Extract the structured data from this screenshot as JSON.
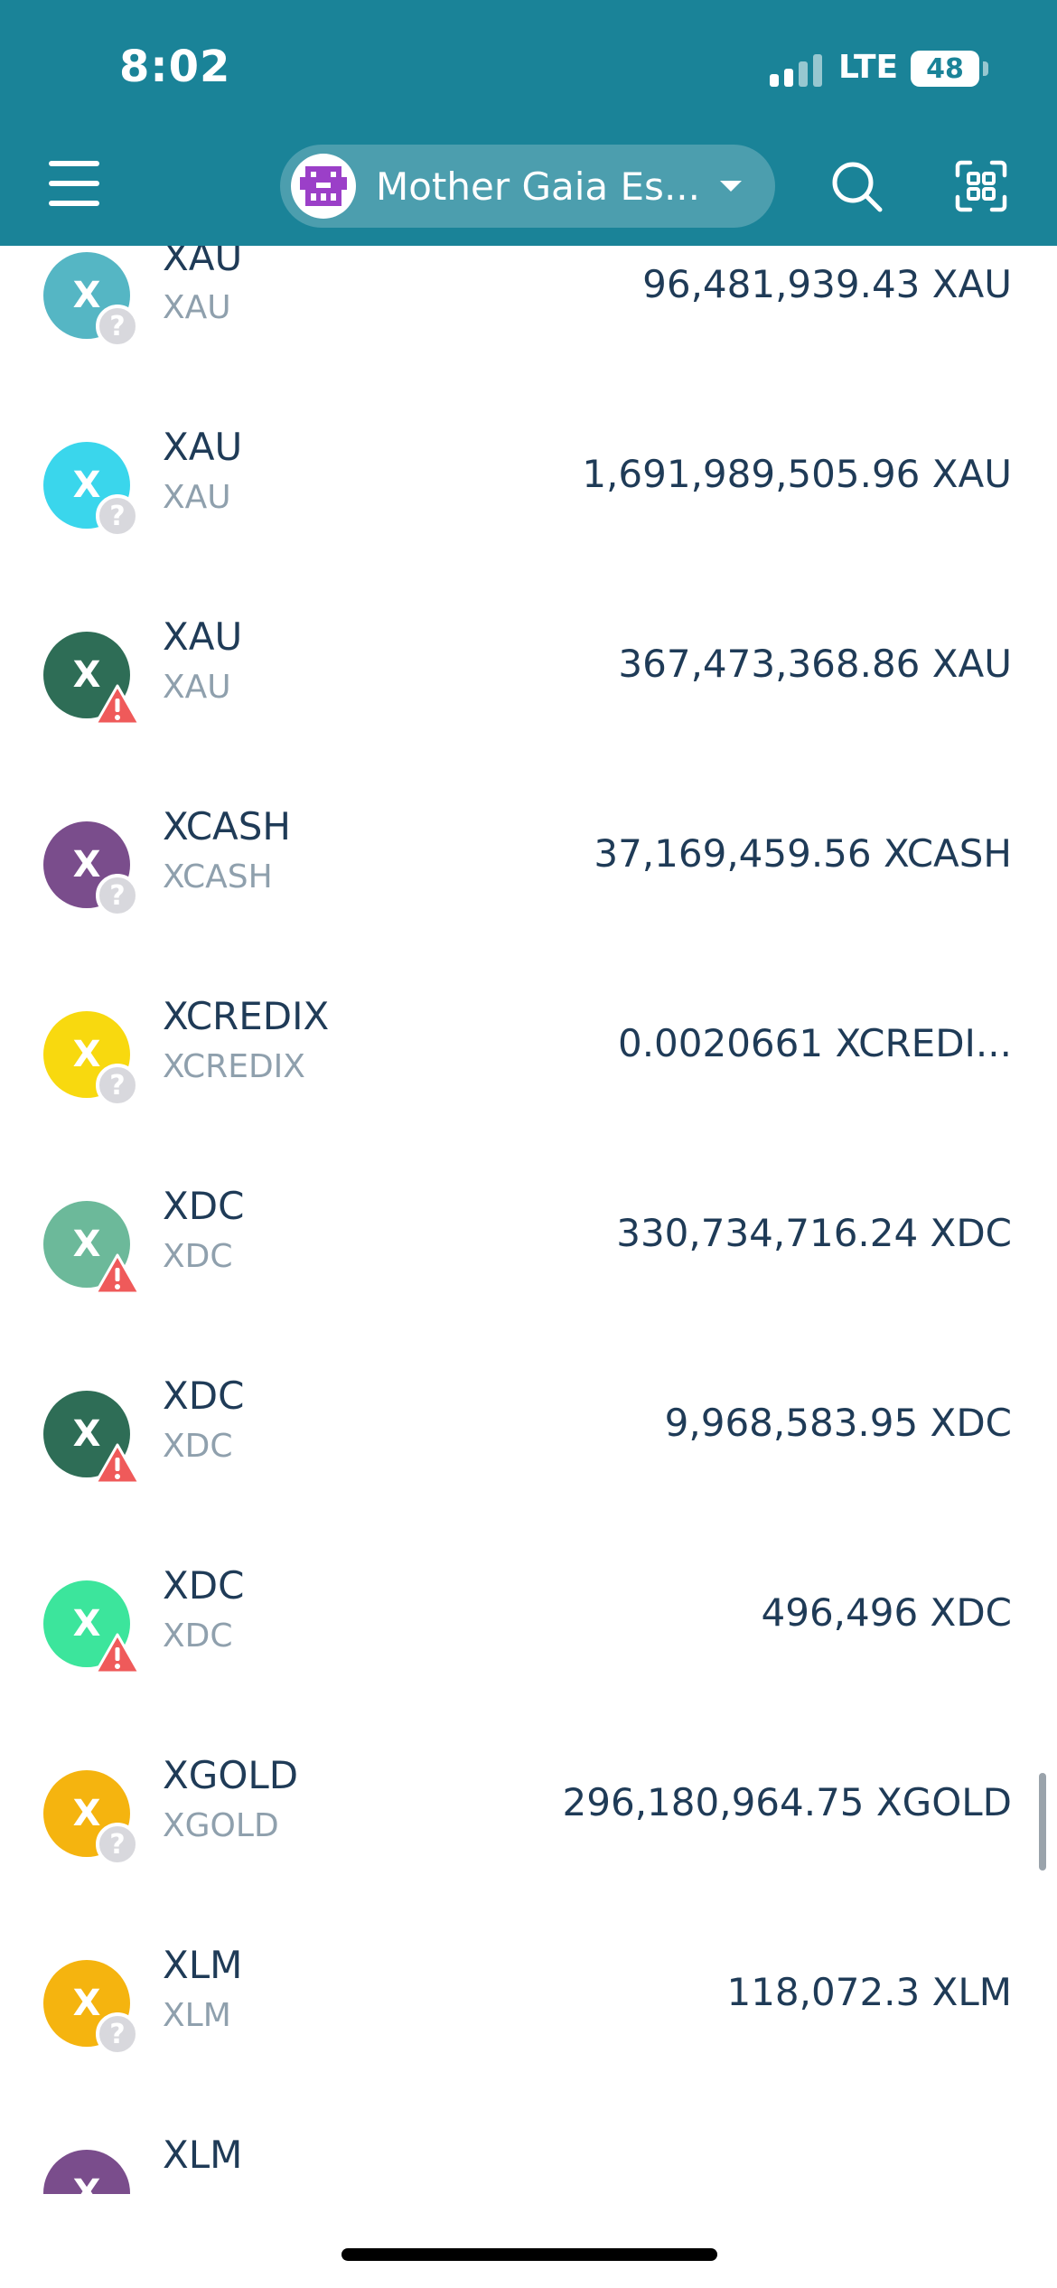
{
  "status_bar": {
    "time": "8:02",
    "network": "LTE",
    "battery": "48"
  },
  "header": {
    "wallet_name": "Mother Gaia Es...",
    "menu_icon": "hamburger-menu-icon",
    "search_icon": "search-icon",
    "scan_icon": "qr-scan-icon"
  },
  "tokens": [
    {
      "letter": "X",
      "symbol": "XAU",
      "subtitle": "XAU",
      "balance": "96,481,939.43 XAU",
      "color": "#55b6c4",
      "badge": "question"
    },
    {
      "letter": "X",
      "symbol": "XAU",
      "subtitle": "XAU",
      "balance": "1,691,989,505.96 XAU",
      "color": "#3ad6ec",
      "badge": "question"
    },
    {
      "letter": "X",
      "symbol": "XAU",
      "subtitle": "XAU",
      "balance": "367,473,368.86 XAU",
      "color": "#2e6d56",
      "badge": "warning"
    },
    {
      "letter": "X",
      "symbol": "XCASH",
      "subtitle": "XCASH",
      "balance": "37,169,459.56 XCASH",
      "color": "#7a4d8c",
      "badge": "question"
    },
    {
      "letter": "X",
      "symbol": "XCREDIX",
      "subtitle": "XCREDIX",
      "balance": "0.0020661 XCREDI...",
      "color": "#f8d90f",
      "badge": "question"
    },
    {
      "letter": "X",
      "symbol": "XDC",
      "subtitle": "XDC",
      "balance": "330,734,716.24 XDC",
      "color": "#6cb99a",
      "badge": "warning"
    },
    {
      "letter": "X",
      "symbol": "XDC",
      "subtitle": "XDC",
      "balance": "9,968,583.95 XDC",
      "color": "#2e6d56",
      "badge": "warning"
    },
    {
      "letter": "X",
      "symbol": "XDC",
      "subtitle": "XDC",
      "balance": "496,496 XDC",
      "color": "#3ce59c",
      "badge": "warning"
    },
    {
      "letter": "X",
      "symbol": "XGOLD",
      "subtitle": "XGOLD",
      "balance": "296,180,964.75 XGOLD",
      "color": "#f5b40f",
      "badge": "question"
    },
    {
      "letter": "X",
      "symbol": "XLM",
      "subtitle": "XLM",
      "balance": "118,072.3 XLM",
      "color": "#f5b40f",
      "badge": "question"
    },
    {
      "letter": "X",
      "symbol": "XLM",
      "subtitle": "",
      "balance": "",
      "color": "#7a4d8c",
      "badge": "none"
    }
  ]
}
